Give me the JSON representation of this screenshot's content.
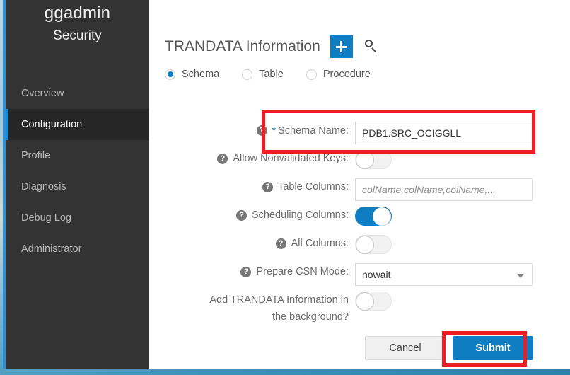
{
  "sidebar": {
    "brand_name": "ggadmin",
    "brand_sub": "Security",
    "items": [
      {
        "label": "Overview",
        "active": false
      },
      {
        "label": "Configuration",
        "active": true
      },
      {
        "label": "Profile",
        "active": false
      },
      {
        "label": "Diagnosis",
        "active": false
      },
      {
        "label": "Debug Log",
        "active": false
      },
      {
        "label": "Administrator",
        "active": false
      }
    ]
  },
  "content": {
    "page_title": "TRANDATA Information",
    "add_icon": "plus-icon",
    "search_icon": "search-icon",
    "radio_options": [
      {
        "label": "Schema",
        "selected": true
      },
      {
        "label": "Table",
        "selected": false
      },
      {
        "label": "Procedure",
        "selected": false
      }
    ],
    "form": {
      "schema_name": {
        "label": "Schema Name:",
        "required_marker": "*",
        "value": "PDB1.SRC_OCIGGLL",
        "help_icon": "help-circle-icon"
      },
      "allow_nonvalidated_keys": {
        "label": "Allow Nonvalidated Keys:",
        "state": "off",
        "help_icon": "help-circle-icon"
      },
      "table_columns": {
        "label": "Table Columns:",
        "value": "",
        "placeholder": "colName,colName,colName,...",
        "help_icon": "help-circle-icon"
      },
      "scheduling_columns": {
        "label": "Scheduling Columns:",
        "state": "on",
        "help_icon": "help-circle-icon"
      },
      "all_columns": {
        "label": "All Columns:",
        "state": "off",
        "help_icon": "help-circle-icon"
      },
      "prepare_csn_mode": {
        "label": "Prepare CSN Mode:",
        "value": "nowait",
        "help_icon": "help-circle-icon"
      },
      "background": {
        "label": "Add TRANDATA Information in the background?",
        "state": "off"
      }
    },
    "buttons": {
      "cancel": "Cancel",
      "submit": "Submit"
    }
  },
  "colors": {
    "accent_blue": "#0f7dc2",
    "sidebar_bg": "#333333",
    "sidebar_active_bg": "#262626",
    "active_marker": "#1b8ad6",
    "highlight_red": "#ee1c25",
    "label_gray": "#6b6b6b"
  },
  "annotations": {
    "schema_name_highlight": "red-rectangle",
    "submit_highlight": "red-rectangle"
  },
  "help_glyph": "?"
}
